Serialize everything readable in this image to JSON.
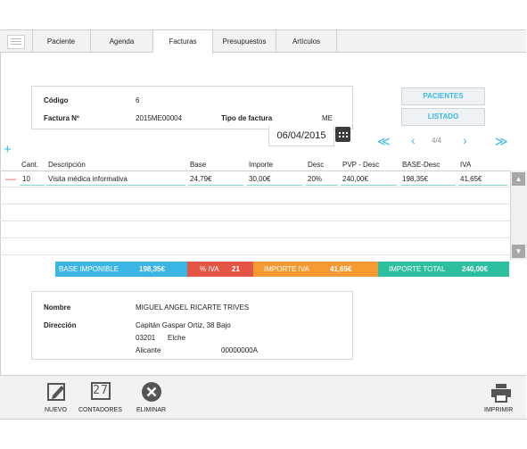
{
  "tabs": [
    "Paciente",
    "Agenda",
    "Facturas",
    "Presupuestos",
    "Artículos"
  ],
  "active_tab": "Facturas",
  "invoice": {
    "codigo_label": "Código",
    "codigo_value": "6",
    "factura_label": "Factura Nº",
    "factura_value": "2015ME00004",
    "tipo_label": "Tipo de factura",
    "tipo_value": "ME",
    "date": "06/04/2015"
  },
  "side_buttons": {
    "pacientes": "PACIENTES",
    "listado": "LISTADO"
  },
  "pager": {
    "text": "4/4"
  },
  "table": {
    "headers": [
      "Cant.",
      "Descripción",
      "Base",
      "Importe",
      "Desc",
      "PVP - Desc",
      "BASE-Desc",
      "IVA"
    ],
    "rows": [
      [
        "10",
        "Visita médica informativa",
        "24,79€",
        "30,00€",
        "20%",
        "240,00€",
        "198,35€",
        "41,65€"
      ]
    ]
  },
  "totals": {
    "base_label": "BASE IMPONIBLE",
    "base_value": "198,35€",
    "iva_pct_label": "% IVA",
    "iva_pct_value": "21",
    "iva_label": "IMPORTE IVA",
    "iva_value": "41,65€",
    "total_label": "IMPORTE TOTAL",
    "total_value": "240,00€",
    "colors": {
      "base": "#3bb5e3",
      "iva_pct": "#e45546",
      "iva": "#f59a33",
      "total": "#2bbf9f"
    }
  },
  "patient": {
    "nombre_label": "Nombre",
    "nombre_value": "MIGUEL ANGEL RICARTE TRIVES",
    "direccion_label": "Dirección",
    "address_line1": "Capitán Gaspar Ortiz, 38 Bajo",
    "postal_code": "03201",
    "city": "Elche",
    "province": "Alicante",
    "phone": "00000000A"
  },
  "footer": {
    "nuevo": "NUEVO",
    "contadores": "CONTADORES",
    "contadores_icon_text": "27",
    "eliminar": "ELIMINAR",
    "imprimir": "IMPRIMIR"
  },
  "accent_color": "#3ab7e0"
}
